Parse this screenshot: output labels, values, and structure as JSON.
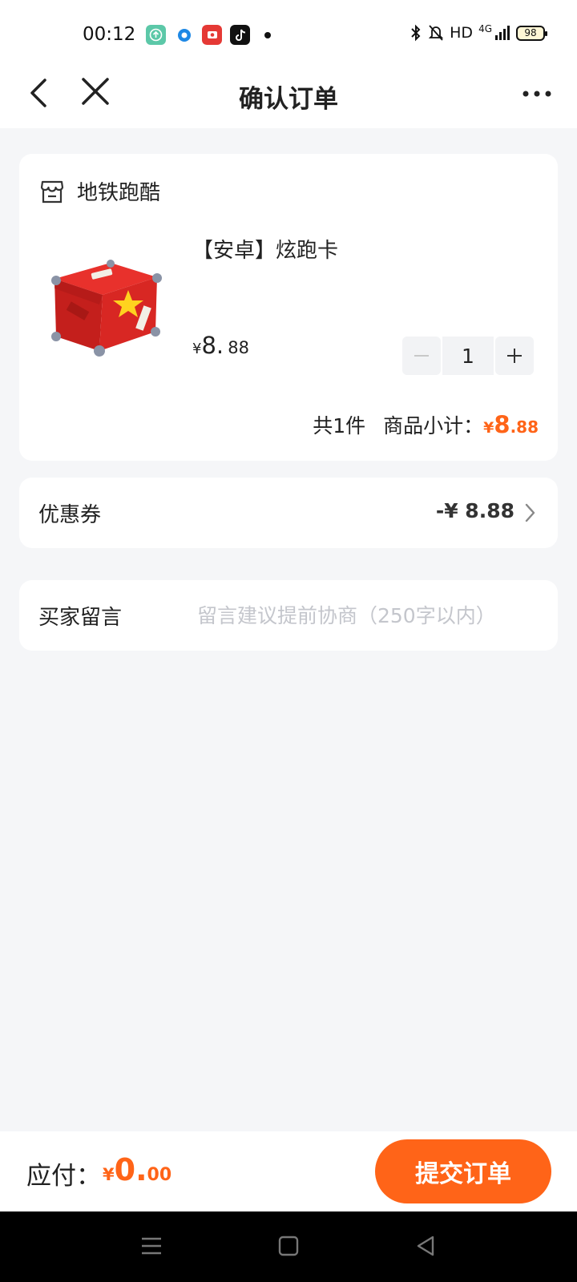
{
  "status_bar": {
    "time": "00:12",
    "network": "HD",
    "network_type": "4G",
    "battery": "98"
  },
  "nav": {
    "title": "确认订单"
  },
  "shop": {
    "name": "地铁跑酷"
  },
  "product": {
    "title": "【安卓】炫跑卡",
    "price_currency": "¥",
    "price_int": "8.",
    "price_dec": "88",
    "quantity": "1"
  },
  "summary": {
    "count": "共1件",
    "subtotal_label": "商品小计：",
    "currency": "¥",
    "int": "8",
    "dec": ".88"
  },
  "coupon": {
    "label": "优惠券",
    "value": "-¥ 8.88"
  },
  "message": {
    "label": "买家留言",
    "placeholder": "留言建议提前协商（250字以内）",
    "value": ""
  },
  "payment": {
    "label": "应付：",
    "currency": "¥",
    "int": "0.",
    "dec": "00",
    "submit_label": "提交订单"
  },
  "colors": {
    "accent": "#ff6418",
    "background": "#f5f6f8"
  }
}
